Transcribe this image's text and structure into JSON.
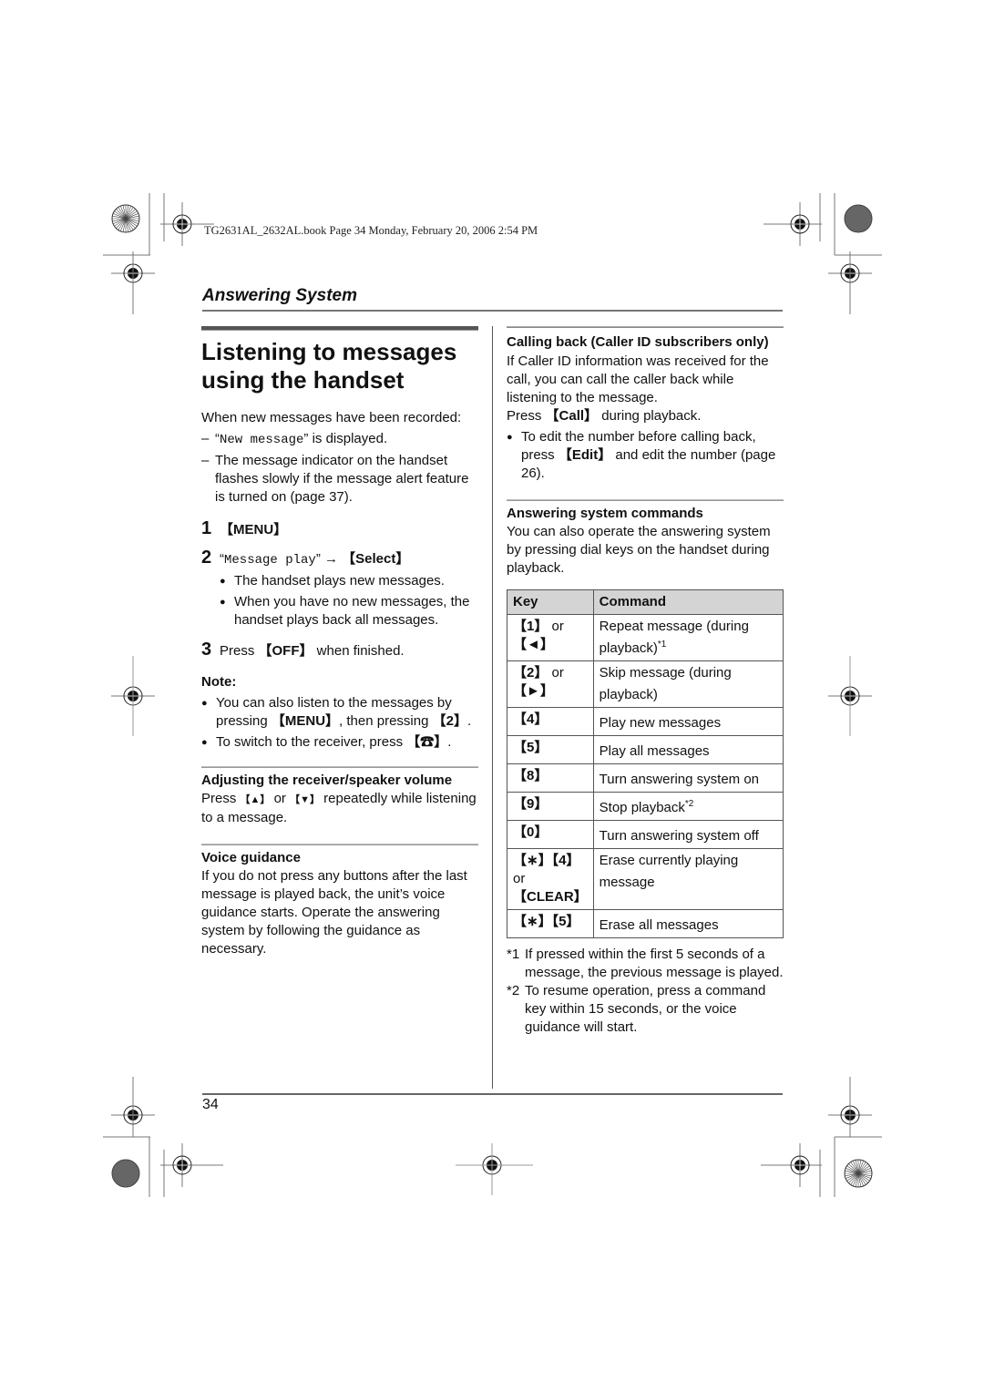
{
  "header": {
    "stamp": "TG2631AL_2632AL.book  Page 34  Monday, February 20, 2006  2:54 PM",
    "section": "Answering System"
  },
  "left": {
    "title": "Listening to messages using the handset",
    "intro": "When new messages have been recorded:",
    "dash1_mono": "New message",
    "dash1_rest": "” is displayed.",
    "dash1_open": "“",
    "dash2": "The message indicator on the handset flashes slowly if the message alert feature is turned on (page 37).",
    "step1": {
      "num": "1",
      "key": "【MENU】"
    },
    "step2": {
      "num": "2",
      "open": "“",
      "mono": "Message play",
      "close": "” → ",
      "key": "【Select】",
      "bullets": [
        "The handset plays new messages.",
        "When you have no new messages, the handset plays back all messages."
      ]
    },
    "step3": {
      "num": "3",
      "pre": "Press ",
      "key": "【OFF】",
      "post": " when finished."
    },
    "note_label": "Note:",
    "note1_pre": "You can also listen to the messages by pressing ",
    "note1_key1": "【MENU】",
    "note1_mid": ", then pressing ",
    "note1_key2": "【2】",
    "note1_post": ".",
    "note2_pre": "To switch to the receiver, press ",
    "note2_key": "【☎】",
    "note2_post": ".",
    "volume_heading": "Adjusting the receiver/speaker volume",
    "volume_pre": "Press ",
    "volume_key1": "【▲】",
    "volume_mid": " or ",
    "volume_key2": "【▼】",
    "volume_post": " repeatedly while listening to a message.",
    "voice_heading": "Voice guidance",
    "voice_text": "If you do not press any buttons after the last message is played back, the unit’s voice guidance starts. Operate the answering system by following the guidance as necessary."
  },
  "right": {
    "callback_heading": "Calling back (Caller ID subscribers only)",
    "callback_text": "If Caller ID information was received for the call, you can call the caller back while listening to the message.",
    "callback_press_pre": "Press ",
    "callback_press_key": "【Call】",
    "callback_press_post": " during playback.",
    "callback_bullet_pre": "To edit the number before calling back, press ",
    "callback_bullet_key": "【Edit】",
    "callback_bullet_post": " and edit the number (page 26).",
    "commands_heading": "Answering system commands",
    "commands_text": "You can also operate the answering system by pressing dial keys on the handset during playback.",
    "table": {
      "headers": [
        "Key",
        "Command"
      ],
      "rows": [
        {
          "key": "【1】",
          "or": " or ",
          "key2": "【◄】",
          "command": "Repeat message (during playback)",
          "sup": "*1"
        },
        {
          "key": "【2】",
          "or": " or ",
          "key2": "【►】",
          "command": "Skip message (during playback)",
          "sup": ""
        },
        {
          "key": "【4】",
          "or": "",
          "key2": "",
          "command": "Play new messages",
          "sup": ""
        },
        {
          "key": "【5】",
          "or": "",
          "key2": "",
          "command": "Play all messages",
          "sup": ""
        },
        {
          "key": "【8】",
          "or": "",
          "key2": "",
          "command": "Turn answering system on",
          "sup": ""
        },
        {
          "key": "【9】",
          "or": "",
          "key2": "",
          "command": "Stop playback",
          "sup": "*2"
        },
        {
          "key": "【0】",
          "or": "",
          "key2": "",
          "command": "Turn answering system off",
          "sup": ""
        },
        {
          "key": "【∗】【4】",
          "or": " or ",
          "key2": "【CLEAR】",
          "command": "Erase currently playing message",
          "sup": ""
        },
        {
          "key": "【∗】【5】",
          "or": "",
          "key2": "",
          "command": "Erase all messages",
          "sup": ""
        }
      ]
    },
    "footnotes": [
      {
        "mark": "*1",
        "text": "If pressed within the first 5 seconds of a message, the previous message is played."
      },
      {
        "mark": "*2",
        "text": "To resume operation, press a command key within 15 seconds, or the voice guidance will start."
      }
    ]
  },
  "footer": {
    "page_number": "34"
  }
}
